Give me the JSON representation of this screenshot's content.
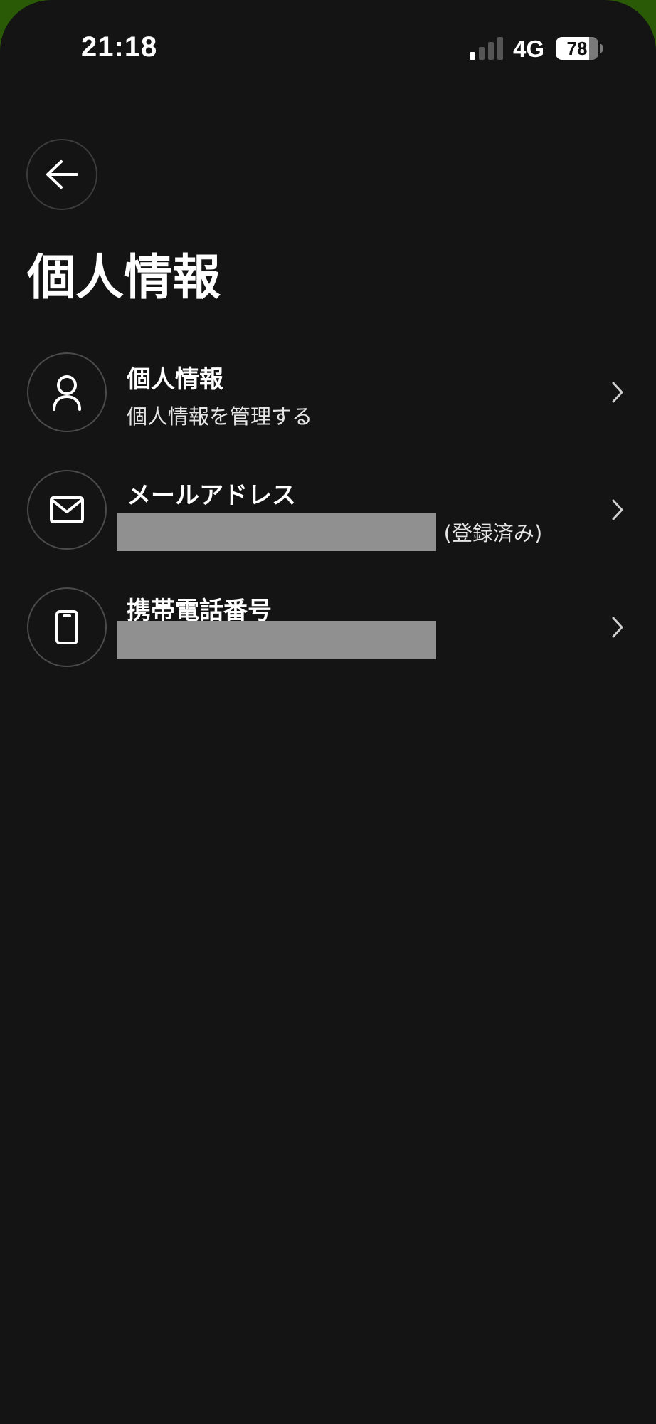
{
  "status_bar": {
    "time": "21:18",
    "network": "4G",
    "battery_level": "78",
    "battery_fraction": 0.78,
    "signal_bars_active": 1,
    "signal_bars_total": 4
  },
  "header": {
    "back_icon": "arrow-left-icon",
    "title": "個人情報"
  },
  "items": [
    {
      "icon": "person-icon",
      "title": "個人情報",
      "subtitle": "個人情報を管理する",
      "chevron_icon": "chevron-right-icon"
    },
    {
      "icon": "mail-icon",
      "title": "メールアドレス",
      "subtitle_visible_tail": "n (登録済み)",
      "subtitle_redacted": true,
      "chevron_icon": "chevron-right-icon"
    },
    {
      "icon": "phone-icon",
      "title": "携帯電話番号",
      "subtitle_redacted": true,
      "chevron_icon": "chevron-right-icon"
    }
  ],
  "colors": {
    "background": "#131413",
    "outer_background": "#2a5a06",
    "text_primary": "#ffffff",
    "icon_border": "#4a4b4a",
    "redaction": "#909090"
  }
}
